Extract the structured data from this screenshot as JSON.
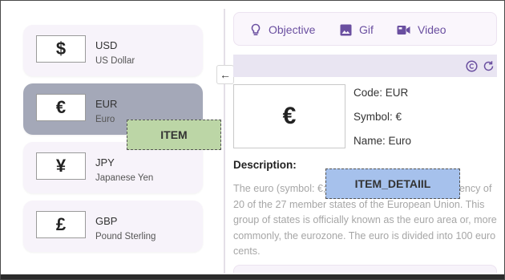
{
  "currencies": [
    {
      "symbol": "$",
      "code": "USD",
      "name": "US Dollar"
    },
    {
      "symbol": "€",
      "code": "EUR",
      "name": "Euro"
    },
    {
      "symbol": "¥",
      "code": "JPY",
      "name": "Japanese Yen"
    },
    {
      "symbol": "£",
      "code": "GBP",
      "name": "Pound Sterling"
    }
  ],
  "selected_index": 1,
  "collapse_glyph": "←",
  "tabs": [
    {
      "label": "Objective",
      "icon": "lightbulb-icon"
    },
    {
      "label": "Gif",
      "icon": "image-icon"
    },
    {
      "label": "Video",
      "icon": "video-camera-icon"
    }
  ],
  "toolbar_icons": [
    "copyright-icon",
    "refresh-icon"
  ],
  "detail": {
    "symbol": "€",
    "code_line": "Code: EUR",
    "symbol_line": "Symbol: €",
    "name_line": "Name: Euro",
    "description_heading": "Description:",
    "description": "The euro (symbol: €; code: EUR) is the official currency of 20 of the 27 member states of the European Union. This group of states is officially known as the euro area or, more commonly, the eurozone. The euro is divided into 100 euro cents."
  },
  "overlays": {
    "item": "ITEM",
    "item_detail": "ITEM_DETAIIL"
  },
  "colors": {
    "accent": "#6a4fa0",
    "selected_card": "#a4a8b8",
    "card": "#f7f3fa",
    "item_overlay": "#bcd6a6",
    "detail_overlay": "#a6c1ec"
  }
}
